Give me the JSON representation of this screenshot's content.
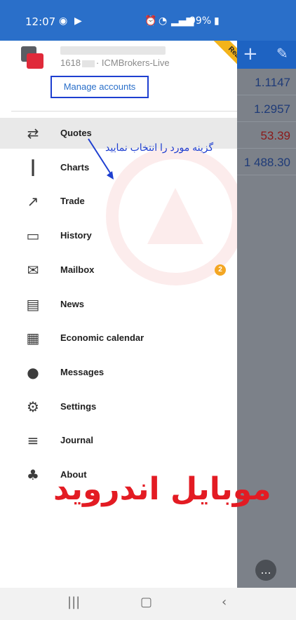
{
  "status_bar": {
    "time": "12:07",
    "icons_left": [
      "whatsapp-icon",
      "play-icon"
    ],
    "icons_right": [
      "alarm-icon",
      "wifi-icon",
      "volte-icon",
      "signal-icon"
    ],
    "battery": "99%"
  },
  "account": {
    "number": "1618",
    "server": "· ICMBrokers-Live",
    "badge": "Real",
    "manage_label": "Manage accounts"
  },
  "menu": [
    {
      "label": "Quotes",
      "icon": "quotes-icon",
      "glyph": "⇄",
      "active": true
    },
    {
      "label": "Charts",
      "icon": "charts-icon",
      "glyph": "┃",
      "active": false
    },
    {
      "label": "Trade",
      "icon": "trade-icon",
      "glyph": "↗",
      "active": false
    },
    {
      "label": "History",
      "icon": "history-icon",
      "glyph": "▭",
      "active": false
    },
    {
      "label": "Mailbox",
      "icon": "mailbox-icon",
      "glyph": "✉",
      "active": false,
      "badge": "2"
    },
    {
      "label": "News",
      "icon": "news-icon",
      "glyph": "▤",
      "active": false
    },
    {
      "label": "Economic calendar",
      "icon": "calendar-icon",
      "glyph": "▦",
      "active": false
    },
    {
      "label": "Messages",
      "icon": "messages-icon",
      "glyph": "●",
      "active": false
    },
    {
      "label": "Settings",
      "icon": "settings-icon",
      "glyph": "⚙",
      "active": false
    },
    {
      "label": "Journal",
      "icon": "journal-icon",
      "glyph": "≡",
      "active": false
    },
    {
      "label": "About",
      "icon": "about-icon",
      "glyph": "♣",
      "active": false
    }
  ],
  "quotes": [
    {
      "value": "1.1147",
      "color": "#1f3b78"
    },
    {
      "value": "1.2957",
      "color": "#1f3b78"
    },
    {
      "value": "53.39",
      "color": "#8b1a1a"
    },
    {
      "value": "1 488.30",
      "color": "#1f3b78"
    }
  ],
  "annotation_text": "گزینه مورد را انتخاب نمایید",
  "overlay_title": "موبایل اندروید",
  "colors": {
    "accent": "#2a6fc9",
    "annotation": "#1e3fd0",
    "title": "#e31b23",
    "badge": "#f3a623",
    "ribbon": "#f3b31a"
  }
}
